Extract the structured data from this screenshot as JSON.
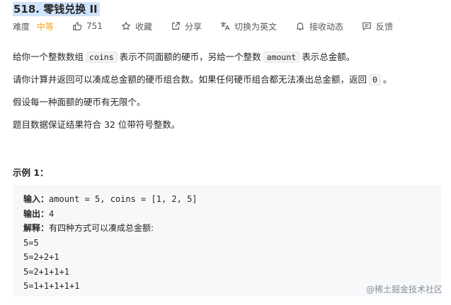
{
  "problem": {
    "title": "518. 零钱兑换 II"
  },
  "meta": {
    "difficulty_label": "难度",
    "difficulty_value": "中等",
    "likes": "751",
    "favorite_label": "收藏",
    "share_label": "分享",
    "language_label": "切换为英文",
    "notify_label": "接收动态",
    "feedback_label": "反馈",
    "difficulty_color": "#ffa116"
  },
  "description": {
    "p1_a": "给你一个整数数组",
    "p1_code1": "coins",
    "p1_b": "表示不同面额的硬币，另给一个整数",
    "p1_code2": "amount",
    "p1_c": "表示总金额。",
    "p2_a": "请你计算并返回可以凑成总金额的硬币组合数。如果任何硬币组合都无法凑出总金额，返回",
    "p2_code": "0",
    "p2_b": "。",
    "p3": "假设每一种面额的硬币有无限个。",
    "p4": "题目数据保证结果符合 32 位带符号整数。"
  },
  "example": {
    "title": "示例 1：",
    "input_label": "输入：",
    "input_value": "amount = 5, coins = [1, 2, 5]",
    "output_label": "输出：",
    "output_value": "4",
    "explain_label": "解释：",
    "explain_value": "有四种方式可以凑成总金额:",
    "lines": [
      "5=5",
      "5=2+2+1",
      "5=2+1+1+1",
      "5=1+1+1+1+1"
    ]
  },
  "watermark": "@稀土掘金技术社区"
}
